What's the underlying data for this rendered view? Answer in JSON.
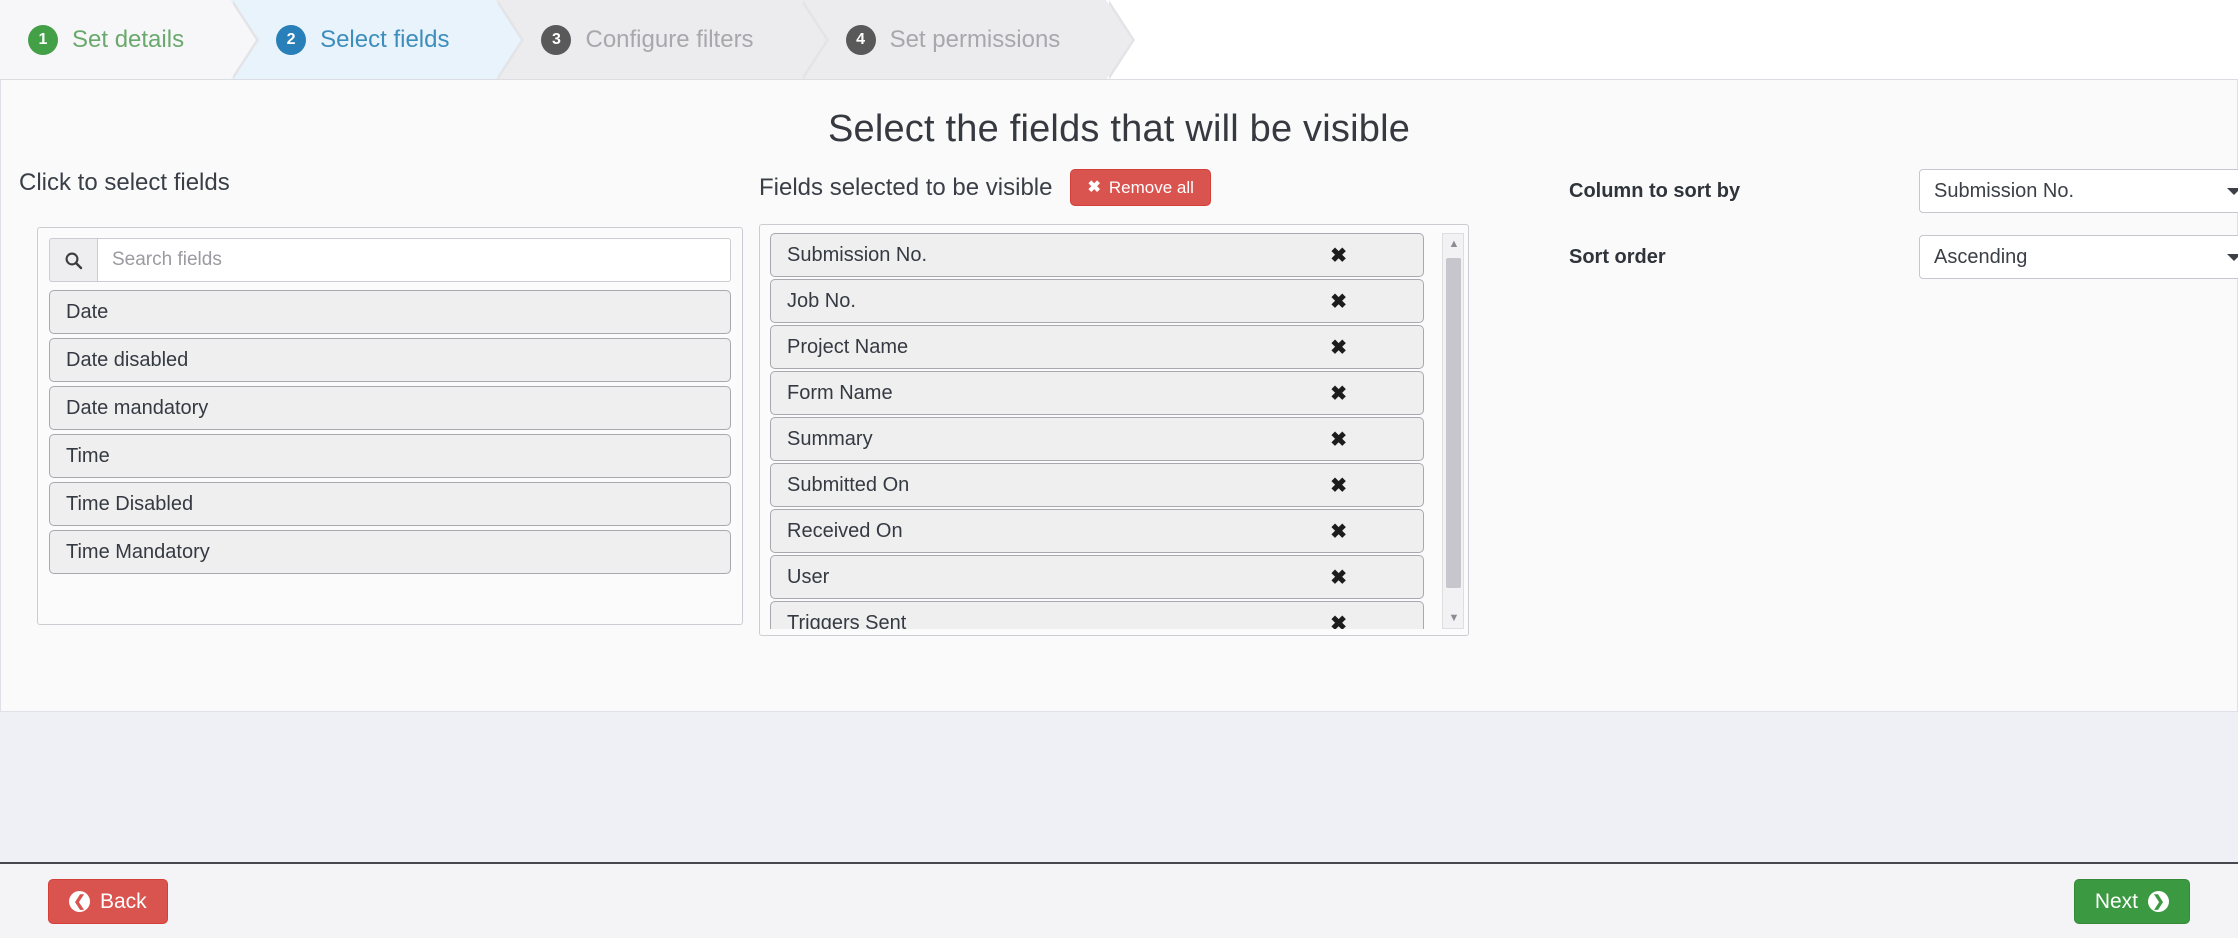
{
  "wizard": {
    "steps": [
      {
        "number": "1",
        "label": "Set details",
        "state": "done"
      },
      {
        "number": "2",
        "label": "Select fields",
        "state": "active"
      },
      {
        "number": "3",
        "label": "Configure filters",
        "state": "pending"
      },
      {
        "number": "4",
        "label": "Set permissions",
        "state": "pending"
      }
    ]
  },
  "page": {
    "title": "Select the fields that will be visible"
  },
  "available": {
    "heading": "Click to select fields",
    "search_placeholder": "Search fields",
    "search_value": "",
    "items": [
      "Date",
      "Date disabled",
      "Date mandatory",
      "Time",
      "Time Disabled",
      "Time Mandatory"
    ]
  },
  "selected": {
    "heading": "Fields selected to be visible",
    "remove_all_label": "Remove all",
    "remove_all_color": "#d9534f",
    "items": [
      "Submission No.",
      "Job No.",
      "Project Name",
      "Form Name",
      "Summary",
      "Submitted On",
      "Received On",
      "User",
      "Triggers Sent"
    ]
  },
  "sort": {
    "column_label": "Column to sort by",
    "column_value": "Submission No.",
    "order_label": "Sort order",
    "order_value": "Ascending"
  },
  "footer": {
    "back_label": "Back",
    "back_color": "#d9534f",
    "next_label": "Next",
    "next_color": "#3b9a41"
  }
}
